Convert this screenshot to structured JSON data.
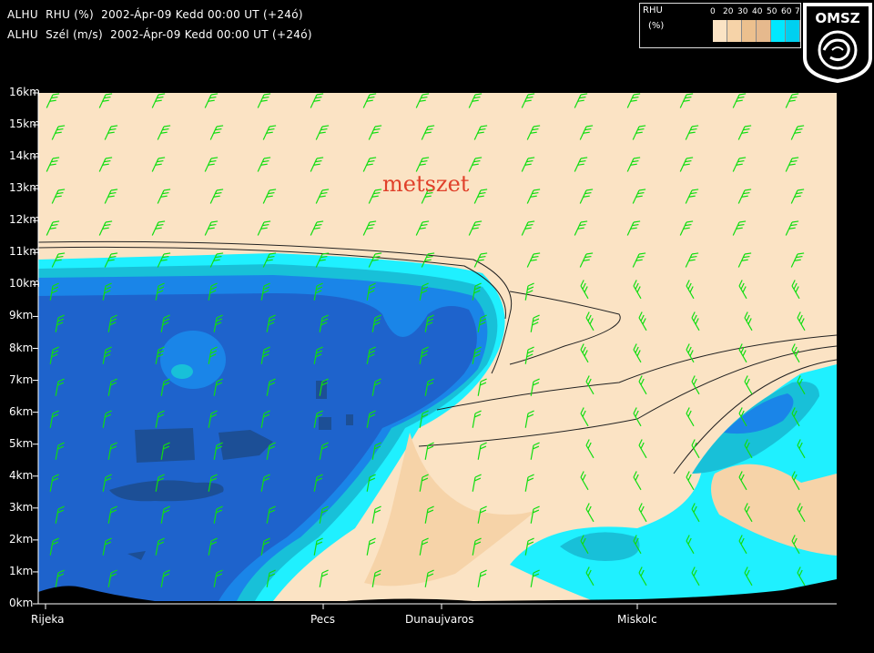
{
  "header": {
    "line1": "ALHU  RHU (%)  2002-Ápr-09 Kedd 00:00 UT (+24ó)",
    "line2": "ALHU  Szél (m/s)  2002-Ápr-09 Kedd 00:00 UT (+24ó)"
  },
  "legend": {
    "variable": "RHU",
    "unit": "(%)",
    "ticks": [
      "0",
      "20",
      "30",
      "40",
      "50",
      "60",
      "7"
    ],
    "colors": [
      "#fbe3c4",
      "#f6d3a8",
      "#ecc08e",
      "#e6b98d",
      "#00e8ff",
      "#00d0f0"
    ]
  },
  "logo": {
    "text": "OMSZ"
  },
  "chart_data": {
    "type": "contour",
    "title": "metszet",
    "y_ticks": [
      "0km",
      "1km",
      "2km",
      "3km",
      "4km",
      "5km",
      "6km",
      "7km",
      "8km",
      "9km",
      "10km",
      "11km",
      "12km",
      "13km",
      "14km",
      "15km",
      "16km"
    ],
    "x_stations": [
      "Rijeka",
      "Pecs",
      "Dunaujvaros",
      "Miskolc"
    ],
    "variables": [
      "RHU (%)",
      "Szél (m/s)"
    ],
    "colors": {
      "very_dry": "#fbe3c4",
      "dry": "#f6d3a8",
      "cyan": "#1ff0ff",
      "teal": "#18c0d8",
      "light_blue": "#1a85e8",
      "blue": "#1e63cc",
      "dark_blue": "#1c4f96",
      "wind_barb": "#11dd11",
      "terrain": "#000000"
    }
  }
}
